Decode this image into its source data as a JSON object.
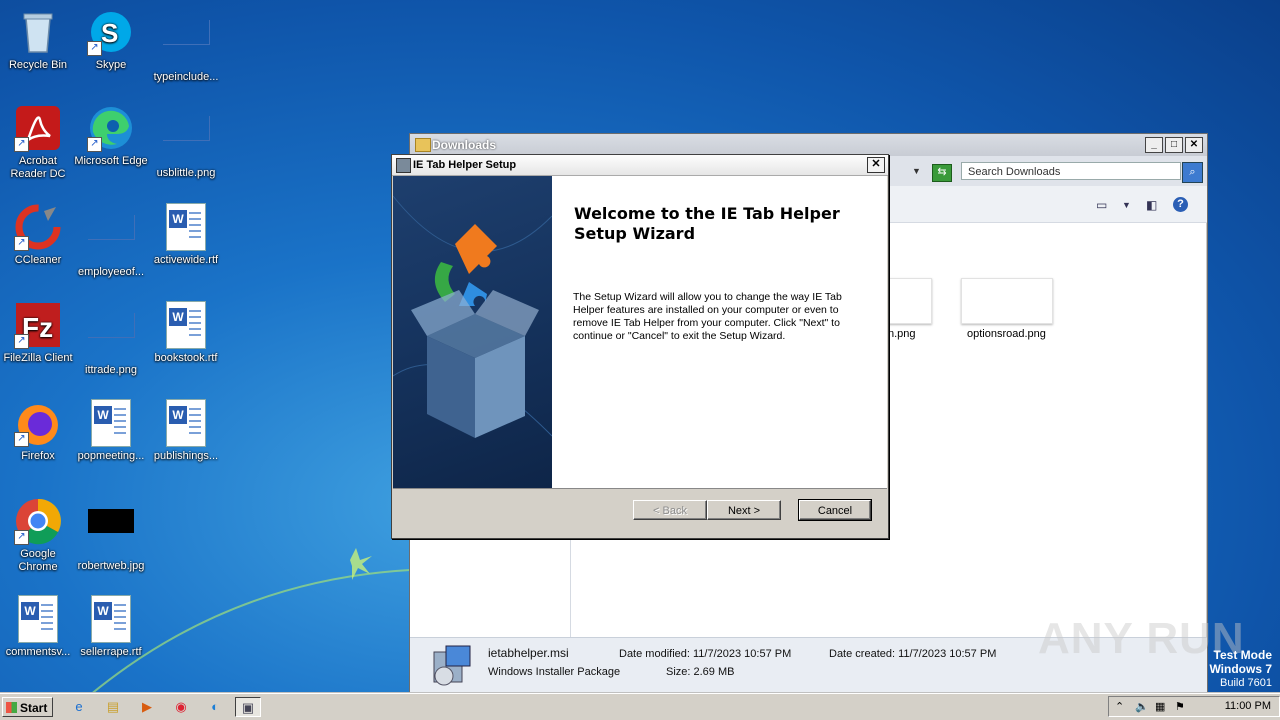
{
  "desktop": {
    "icons": [
      {
        "label": "Recycle Bin"
      },
      {
        "label": "Skype"
      },
      {
        "label": "typeinclude..."
      },
      {
        "label": "Acrobat Reader DC"
      },
      {
        "label": "Microsoft Edge"
      },
      {
        "label": "usblittle.png"
      },
      {
        "label": "CCleaner"
      },
      {
        "label": "employeeof..."
      },
      {
        "label": "activewide.rtf"
      },
      {
        "label": "FileZilla Client"
      },
      {
        "label": "ittrade.png"
      },
      {
        "label": "bookstook.rtf"
      },
      {
        "label": "Firefox"
      },
      {
        "label": "popmeeting..."
      },
      {
        "label": "publishings..."
      },
      {
        "label": "Google Chrome"
      },
      {
        "label": "robertweb.jpg"
      },
      {
        "label": "commentsv..."
      },
      {
        "label": "sellerrape.rtf"
      }
    ]
  },
  "explorer": {
    "title": "Downloads",
    "search_placeholder": "Search Downloads",
    "files": [
      {
        "label": "n.png"
      },
      {
        "label": "optionsroad.png"
      }
    ],
    "details": {
      "name": "ietabhelper.msi",
      "type": "Windows Installer Package",
      "modified": "Date modified: 11/7/2023 10:57 PM",
      "created": "Date created: 11/7/2023 10:57 PM",
      "size": "Size: 2.69 MB"
    }
  },
  "dialog": {
    "title": "IE Tab Helper Setup",
    "heading": "Welcome to the IE Tab Helper Setup Wizard",
    "description": "The Setup Wizard will allow you to change the way IE Tab Helper features are installed on your computer or even to remove IE Tab Helper from your computer.  Click \"Next\" to continue or \"Cancel\" to exit the Setup Wizard.",
    "back_label": "< Back",
    "next_label": "Next >",
    "cancel_label": "Cancel"
  },
  "taskbar": {
    "start_label": "Start",
    "clock": "11:00 PM"
  },
  "watermark": {
    "line1": "Test Mode",
    "line2": "Windows 7",
    "line3": "Build 7601",
    "brand": "ANY RUN"
  },
  "colors": {
    "desktop_blue": "#1a73c8",
    "dialog_gray": "#d4d0c8",
    "banner_navy": "#1e3f6e"
  }
}
